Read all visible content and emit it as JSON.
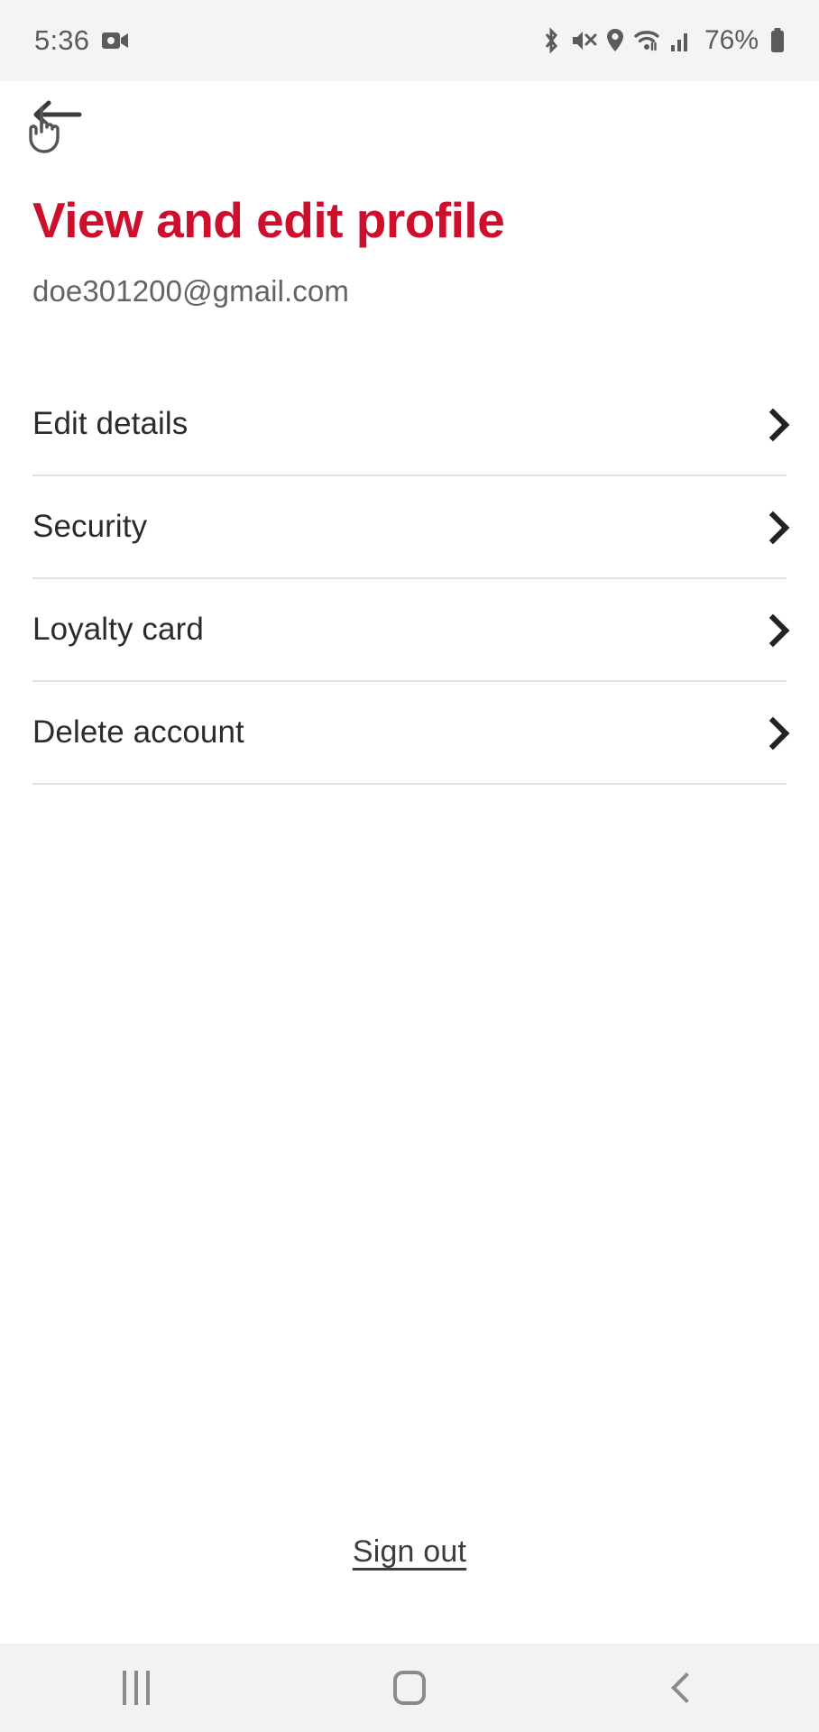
{
  "status_bar": {
    "time": "5:36",
    "battery_percent": "76%",
    "icons": [
      "screen-recording-icon",
      "bluetooth-icon",
      "volume-mute-icon",
      "location-icon",
      "wifi-icon",
      "cellular-signal-icon",
      "battery-icon"
    ]
  },
  "nav": {
    "back_icon": "back-arrow-icon",
    "cursor_icon": "hand-cursor-icon"
  },
  "header": {
    "title": "View and edit profile",
    "email": "doe301200@gmail.com",
    "title_color": "#ce0e2d"
  },
  "menu": {
    "items": [
      {
        "label": "Edit details",
        "chevron": "chevron-right-icon"
      },
      {
        "label": "Security",
        "chevron": "chevron-right-icon"
      },
      {
        "label": "Loyalty card",
        "chevron": "chevron-right-icon"
      },
      {
        "label": "Delete account",
        "chevron": "chevron-right-icon"
      }
    ]
  },
  "footer": {
    "sign_out_label": "Sign out"
  },
  "android_nav": {
    "recents_label": "Recents",
    "home_label": "Home",
    "back_label": "Back"
  }
}
